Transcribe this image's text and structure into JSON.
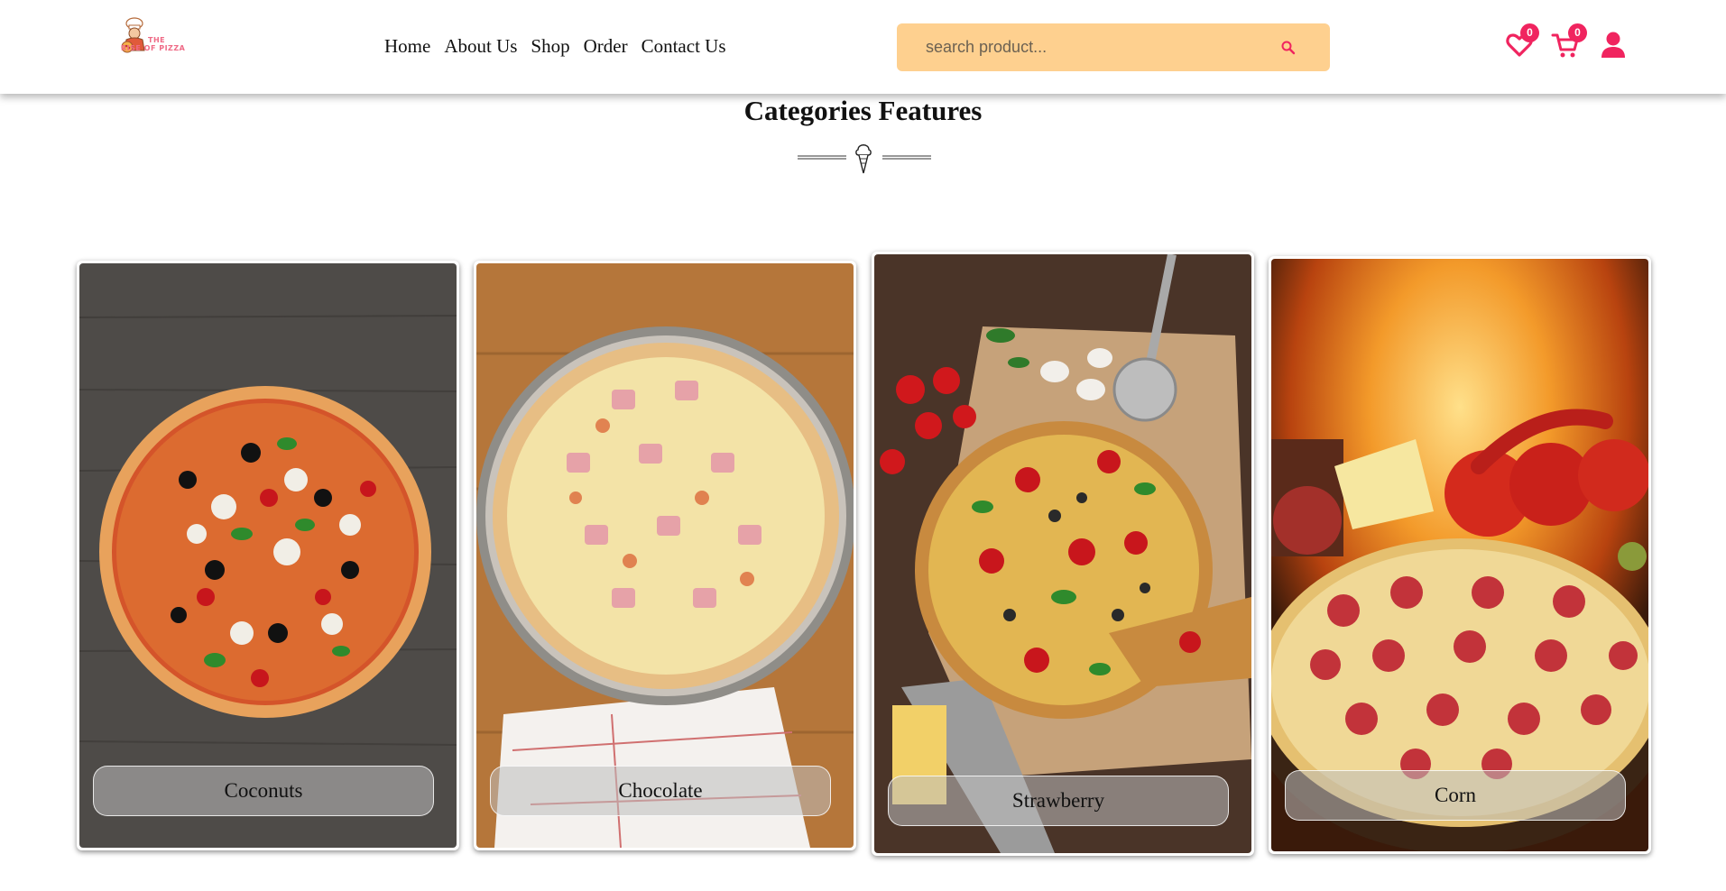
{
  "header": {
    "logo": {
      "line1": "THE",
      "line2": "RISE OF PIZZA"
    },
    "nav": [
      {
        "label": "Home"
      },
      {
        "label": "About Us"
      },
      {
        "label": "Shop"
      },
      {
        "label": "Order"
      },
      {
        "label": "Contact Us"
      }
    ],
    "search": {
      "placeholder": "search product...",
      "icon": "search-icon"
    },
    "wishlist": {
      "icon": "heart-icon",
      "count": "0"
    },
    "cart": {
      "icon": "cart-icon",
      "count": "0"
    },
    "account": {
      "icon": "user-icon"
    }
  },
  "section": {
    "title": "Categories Features",
    "divider_icon": "ice-cream-cone-icon"
  },
  "categories": [
    {
      "label": "Coconuts"
    },
    {
      "label": "Chocolate"
    },
    {
      "label": "Strawberry"
    },
    {
      "label": "Corn"
    }
  ],
  "colors": {
    "accent": "#f0245f",
    "search_bg": "#fed08f",
    "logo": "#ef6a86"
  }
}
